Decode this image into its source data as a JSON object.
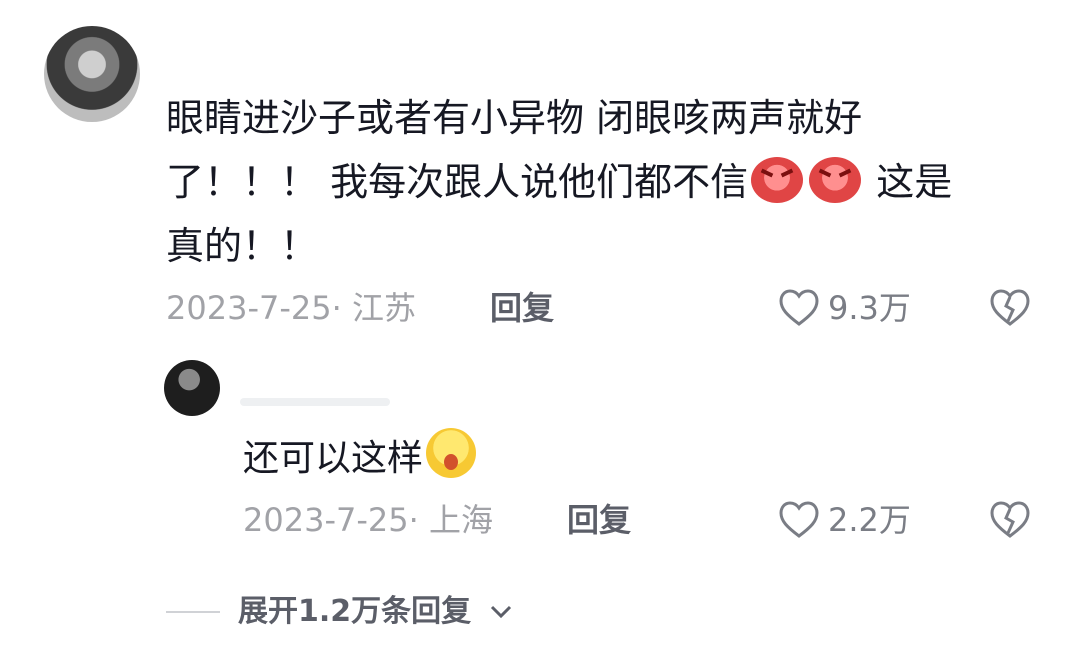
{
  "comment": {
    "lines": [
      "眼睛进沙子或者有小异物 闭眼咳两声就好",
      "了！！！ 我每次跟人说他们都不信",
      "真的！！"
    ],
    "line2_tail": "这是",
    "date_location": "2023-7-25· 江苏",
    "reply_label": "回复",
    "likes": "9.3万",
    "icons": [
      "heart-icon",
      "broken-heart-icon",
      "angry-emoji-icon"
    ]
  },
  "reply": {
    "text": "还可以这样",
    "date_location": "2023-7-25· 上海",
    "reply_label": "回复",
    "likes": "2.2万",
    "icons": [
      "heart-icon",
      "broken-heart-icon",
      "surprised-emoji-icon"
    ]
  },
  "expand": {
    "label": "展开1.2万条回复"
  }
}
